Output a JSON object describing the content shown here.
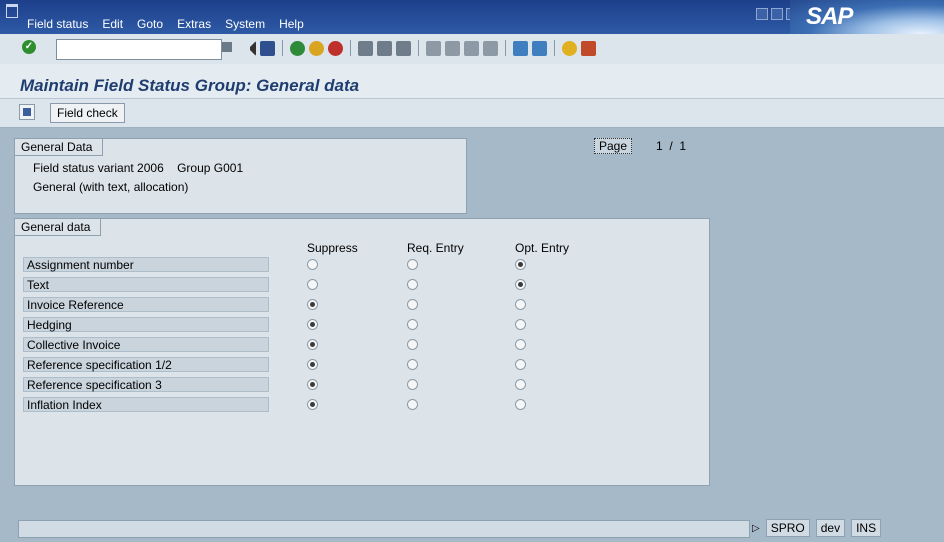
{
  "menu": {
    "items": [
      "Field status",
      "Edit",
      "Goto",
      "Extras",
      "System",
      "Help"
    ]
  },
  "brand": {
    "logo": "SAP"
  },
  "toolbar": {
    "command_value": "",
    "icons": [
      "back-icon",
      "save-icon",
      "back-green-icon",
      "exit-icon",
      "cancel-icon",
      "print-icon",
      "find-icon",
      "find-next-icon",
      "first-page-icon",
      "previous-page-icon",
      "next-page-icon",
      "last-page-icon",
      "create-session-icon",
      "shortcut-icon",
      "help-icon",
      "customize-layout-icon"
    ]
  },
  "title": "Maintain Field Status Group: General data",
  "app_toolbar": {
    "field_check_label": "Field check"
  },
  "general_data_box": {
    "tab": "General Data",
    "line1": "Field status variant 2006    Group G001",
    "line2": "General (with text, allocation)"
  },
  "page": {
    "button": "Page",
    "value": "1  /  1"
  },
  "field_table": {
    "tab": "General data",
    "columns": [
      "Suppress",
      "Req. Entry",
      "Opt. Entry"
    ],
    "rows": [
      {
        "label": "Assignment number",
        "selected": "Opt. Entry"
      },
      {
        "label": "Text",
        "selected": "Opt. Entry"
      },
      {
        "label": "Invoice Reference",
        "selected": "Suppress"
      },
      {
        "label": "Hedging",
        "selected": "Suppress"
      },
      {
        "label": "Collective Invoice",
        "selected": "Suppress"
      },
      {
        "label": "Reference specification 1/2",
        "selected": "Suppress"
      },
      {
        "label": "Reference specification 3",
        "selected": "Suppress"
      },
      {
        "label": "Inflation Index",
        "selected": "Suppress"
      }
    ]
  },
  "status_bar": {
    "transaction": "SPRO",
    "system": "dev",
    "mode": "INS"
  },
  "colors": {
    "title": "#1f3d6f",
    "menubar": "#1d3f8a",
    "background": "#a6b9c9"
  }
}
